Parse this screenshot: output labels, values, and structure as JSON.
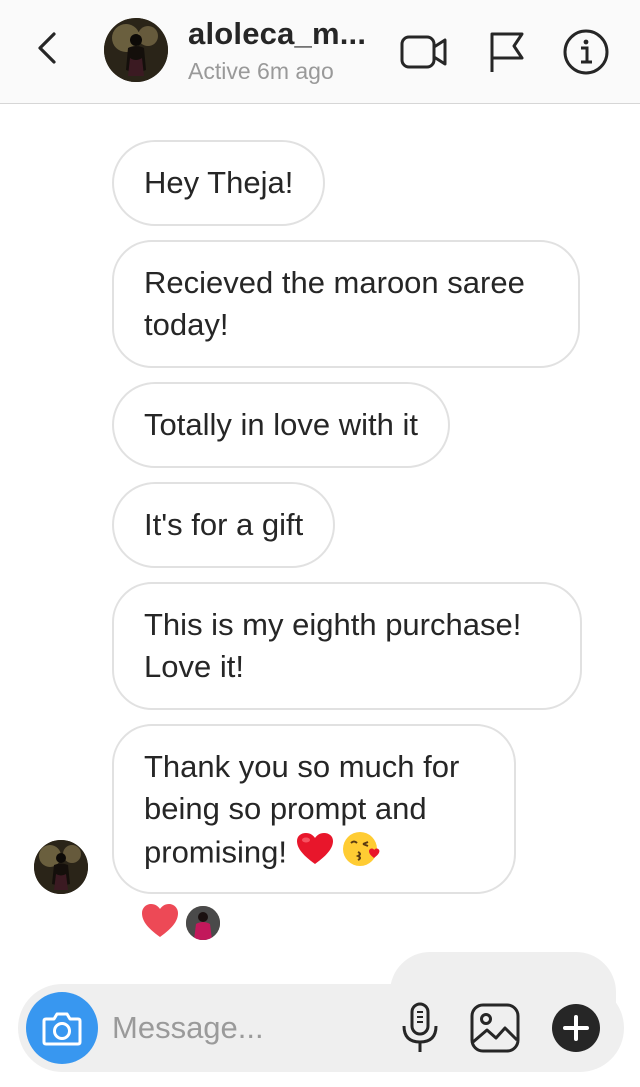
{
  "header": {
    "username": "aloleca_m...",
    "status": "Active 6m ago"
  },
  "icons": {
    "back": "chevron-left-icon",
    "video": "video-camera-icon",
    "flag": "flag-icon",
    "info": "info-icon",
    "camera": "camera-icon",
    "mic": "microphone-icon",
    "gallery": "gallery-icon",
    "plus": "plus-icon"
  },
  "messages": [
    {
      "text": "Hey Theja!"
    },
    {
      "text": "Recieved the maroon saree today!"
    },
    {
      "text": "Totally in love with it"
    },
    {
      "text": "It's for a gift"
    },
    {
      "text": "This is my eighth purchase! Love it!"
    },
    {
      "text": "Thank you so much for being so prompt and promising!"
    }
  ],
  "reactions": {
    "heart": "heart-reaction"
  },
  "composer": {
    "placeholder": "Message..."
  },
  "colors": {
    "accent": "#3897f0",
    "heart": "#ed4956",
    "bubble_border": "#e1e1e1"
  }
}
